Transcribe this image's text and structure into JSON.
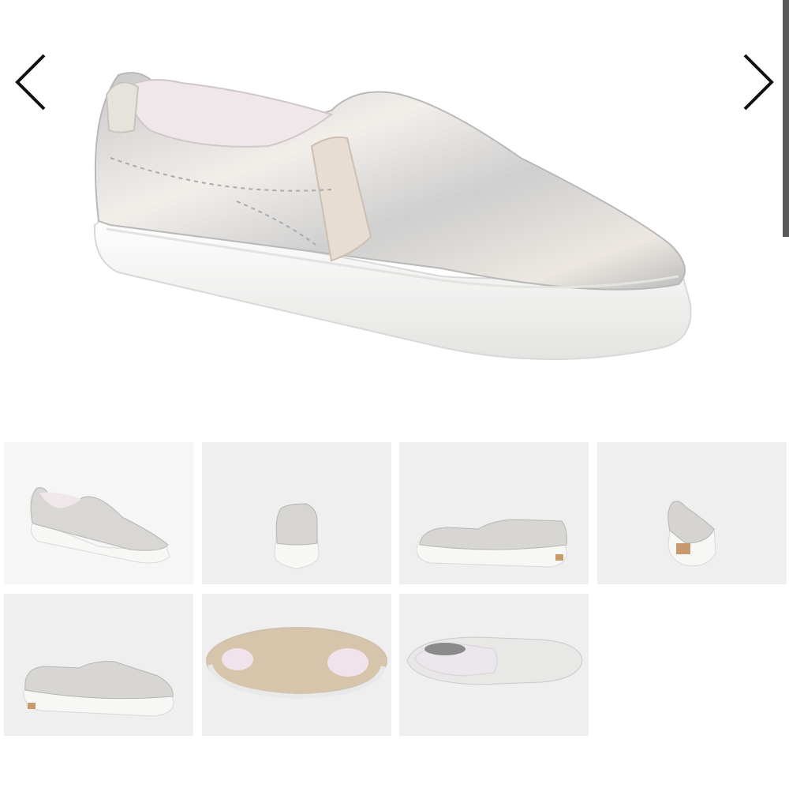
{
  "gallery": {
    "prev_icon": "chevron-left-icon",
    "next_icon": "chevron-right-icon",
    "main_view": "three-quarter-side",
    "selected_index": 0,
    "thumbnails": [
      {
        "view": "three-quarter-side"
      },
      {
        "view": "front"
      },
      {
        "view": "side"
      },
      {
        "view": "back"
      },
      {
        "view": "side-alt"
      },
      {
        "view": "sole"
      },
      {
        "view": "top"
      }
    ],
    "colors": {
      "upper": "#dcdcdc",
      "sole": "#f7f7f5",
      "lining": "#eadfe3",
      "outsole_pattern": "#d7c5ab",
      "thumb_bg": "#efefef"
    }
  }
}
